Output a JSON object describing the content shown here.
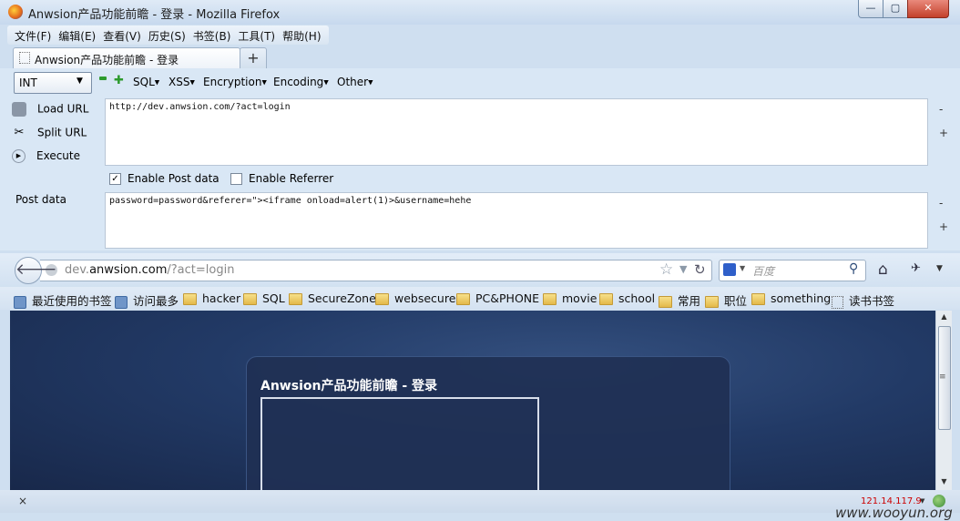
{
  "window": {
    "title": "Anwsion产品功能前瞻 - 登录 - Mozilla Firefox",
    "min_label": "▭",
    "max_label": "▢",
    "close_label": "✕"
  },
  "menu": [
    "文件(F)",
    "编辑(E)",
    "查看(V)",
    "历史(S)",
    "书签(B)",
    "工具(T)",
    "帮助(H)"
  ],
  "tab": {
    "label": "Anwsion产品功能前瞻 - 登录",
    "new_tab_label": "+"
  },
  "hackbar": {
    "select_value": "INT",
    "menus": [
      "SQL",
      "XSS",
      "Encryption",
      "Encoding",
      "Other"
    ],
    "load_url": "Load URL",
    "split_url": "Split URL",
    "execute": "Execute",
    "url_value": "http://dev.anwsion.com/?act=login",
    "enable_post": "Enable Post data",
    "enable_referrer": "Enable Referrer",
    "post_label": "Post data",
    "post_value": "password=password&referer=\"><iframe onload=alert(1)>&username=hehe",
    "minus": "-",
    "plus": "+"
  },
  "navigation": {
    "url_domain_prefix": "dev.",
    "url_domain": "anwsion.com",
    "url_path": "/?act=login",
    "search_placeholder": "百度"
  },
  "bookmarks": [
    "最近使用的书签",
    "访问最多",
    "hacker",
    "SQL",
    "SecureZone",
    "websecure",
    "PC&PHONE",
    "movie",
    "school",
    "常用",
    "职位",
    "something",
    "读书书签"
  ],
  "page": {
    "card_title": "Anwsion产品功能前瞻 - 登录"
  },
  "status": {
    "close": "×",
    "ip": "121.14.117.9"
  },
  "watermark": "www.wooyun.org",
  "colors": {
    "page_bg": "#223a66",
    "ip_text": "#cc0000",
    "chrome_bg": "#d9e7f5"
  }
}
